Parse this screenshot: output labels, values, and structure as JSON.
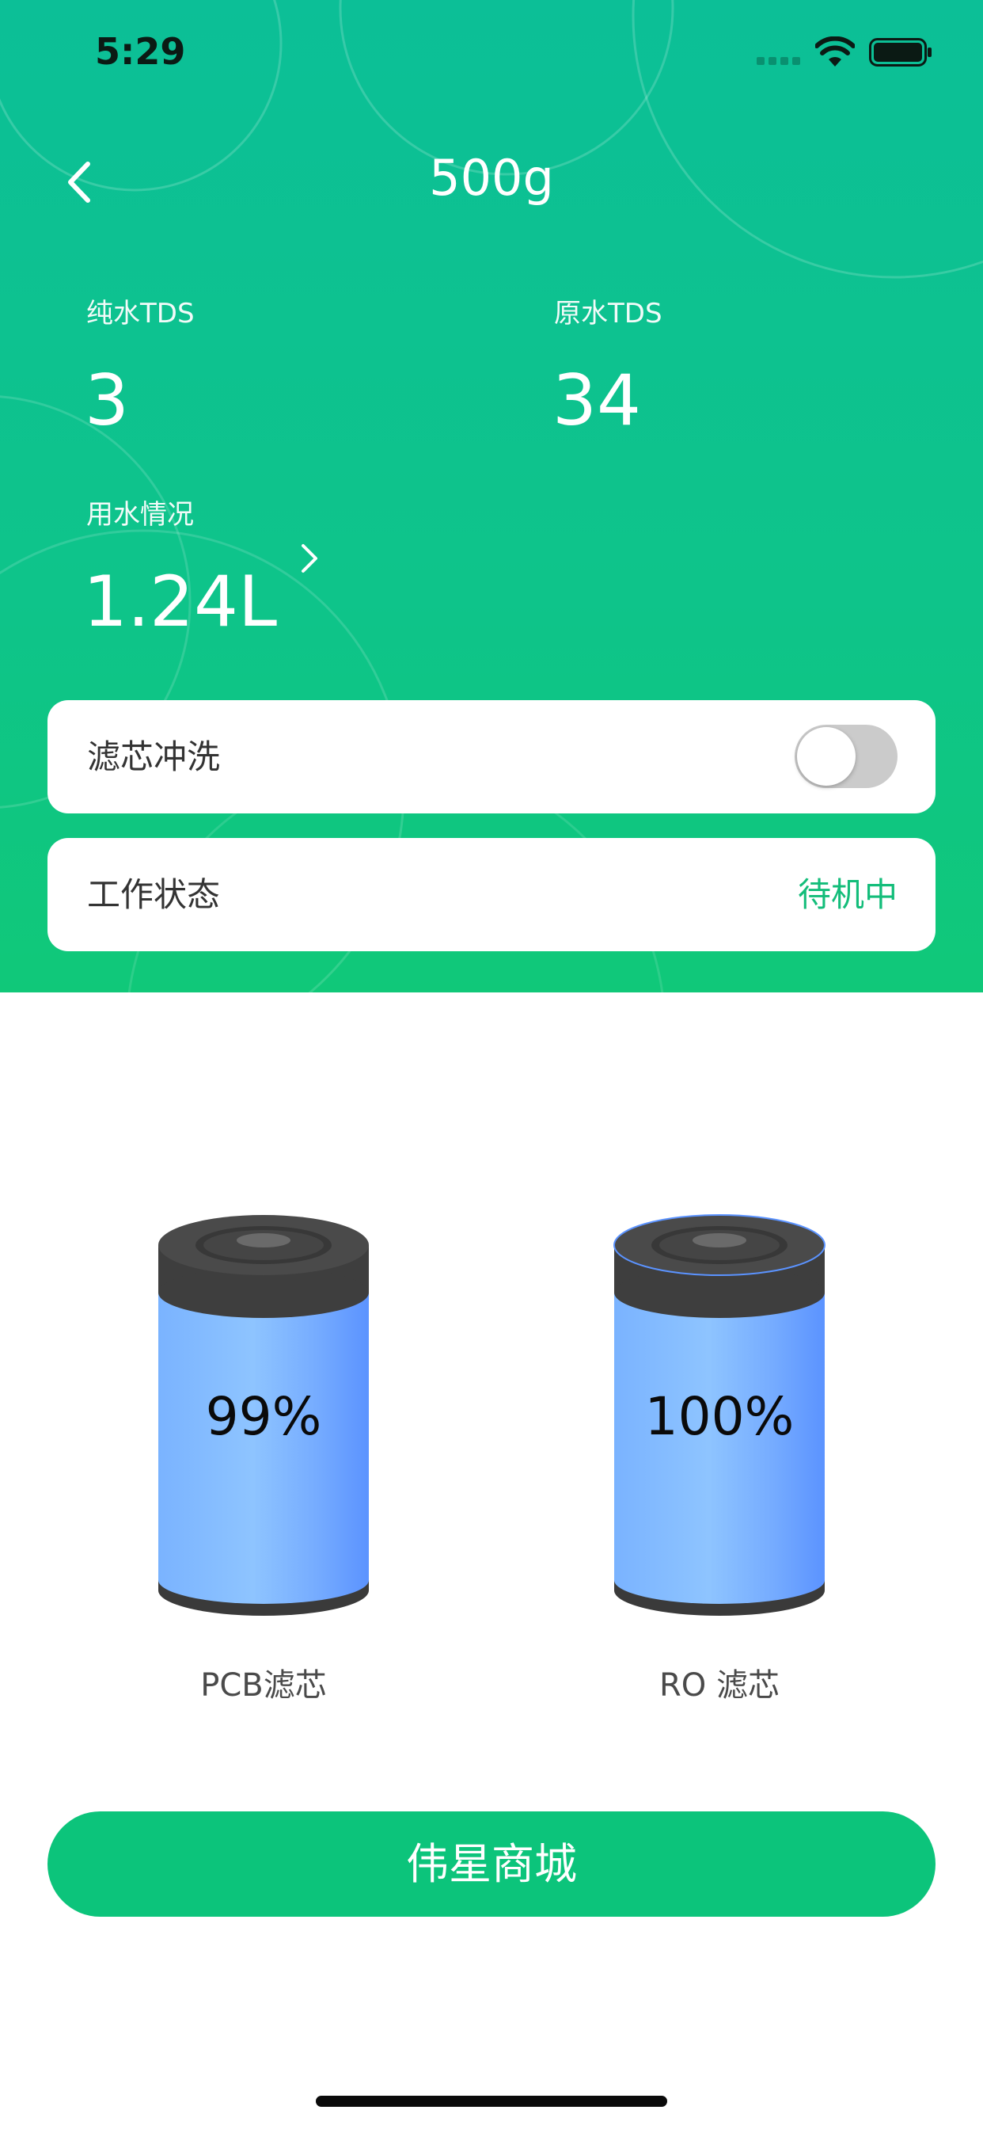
{
  "status_bar": {
    "time": "5:29"
  },
  "header": {
    "title": "500g"
  },
  "stats": {
    "pure_tds": {
      "label": "纯水TDS",
      "value": "3"
    },
    "raw_tds": {
      "label": "原水TDS",
      "value": "34"
    },
    "usage": {
      "label": "用水情况",
      "value": "1.24L"
    }
  },
  "cards": {
    "flush": {
      "label": "滤芯冲洗",
      "toggle_on": false
    },
    "work_status": {
      "label": "工作状态",
      "status": "待机中"
    }
  },
  "filters": [
    {
      "percent": "99%",
      "label": "PCB滤芯"
    },
    {
      "percent": "100%",
      "label": "RO 滤芯"
    }
  ],
  "shop_button": {
    "label": "伟星商城"
  },
  "colors": {
    "brand_green": "#0cc47b",
    "status_green": "#13bd7a",
    "filter_blue": "#6a9fff",
    "filter_cap": "#3c3c3c"
  },
  "icons": [
    "back-icon",
    "chevron-right-icon",
    "signal-icon",
    "wifi-icon",
    "battery-icon"
  ]
}
